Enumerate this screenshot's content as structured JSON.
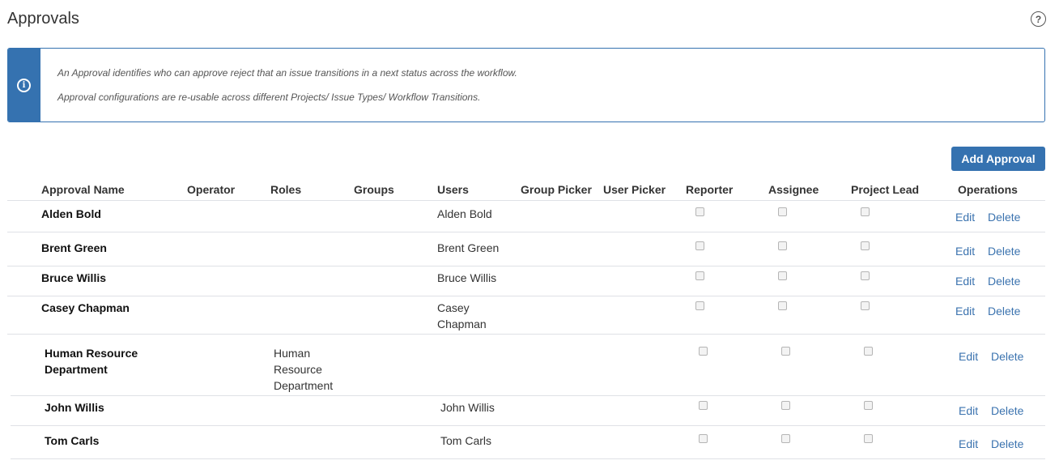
{
  "page": {
    "title": "Approvals",
    "help_icon": "question-circle-icon"
  },
  "info": {
    "icon": "info-circle-icon",
    "line1": "An Approval identifies who can approve reject that an issue transitions in a next status across the workflow.",
    "line2": "Approval configurations are re-usable across different Projects/ Issue Types/ Workflow Transitions."
  },
  "toolbar": {
    "add_label": "Add Approval"
  },
  "table": {
    "headers": [
      "Approval Name",
      "Operator",
      "Roles",
      "Groups",
      "Users",
      "Group Picker",
      "User Picker",
      "Reporter",
      "Assignee",
      "Project Lead",
      "Operations"
    ],
    "edit_label": "Edit",
    "delete_label": "Delete",
    "rows": [
      {
        "name": "Alden Bold",
        "roles": "",
        "users": "Alden Bold",
        "reporter": false,
        "assignee": false,
        "project_lead": false
      },
      {
        "name": "Brent Green",
        "roles": "",
        "users": "Brent Green",
        "reporter": false,
        "assignee": false,
        "project_lead": false
      },
      {
        "name": "Bruce Willis",
        "roles": "",
        "users": "Bruce Willis",
        "reporter": false,
        "assignee": false,
        "project_lead": false
      },
      {
        "name": "Casey Chapman",
        "roles": "",
        "users": "Casey\nChapman",
        "reporter": false,
        "assignee": false,
        "project_lead": false
      },
      {
        "name": "Human Resource\nDepartment",
        "roles": "Human\nResource\nDepartment",
        "users": "",
        "reporter": false,
        "assignee": false,
        "project_lead": false
      },
      {
        "name": "John Willis",
        "roles": "",
        "users": "John Willis",
        "reporter": false,
        "assignee": false,
        "project_lead": false
      },
      {
        "name": "Tom Carls",
        "roles": "",
        "users": "Tom Carls",
        "reporter": false,
        "assignee": false,
        "project_lead": false
      }
    ]
  },
  "colors": {
    "accent": "#3572b0",
    "link": "#3b73af",
    "border": "#dfe1e6"
  }
}
